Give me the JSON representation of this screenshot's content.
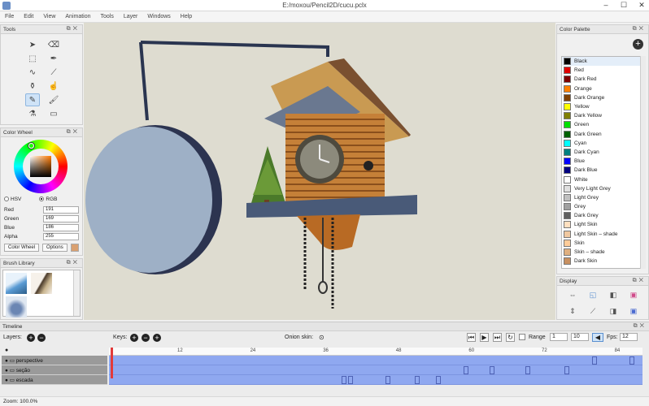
{
  "window": {
    "title": "E:/moxou/Pencil2D/cucu.pclx"
  },
  "menu": [
    "File",
    "Edit",
    "View",
    "Animation",
    "Tools",
    "Layer",
    "Windows",
    "Help"
  ],
  "tools_panel": {
    "title": "Tools"
  },
  "tools": [
    {
      "name": "select-arrow-icon",
      "glyph": "➤",
      "active": false
    },
    {
      "name": "clear-icon",
      "glyph": "⌫",
      "active": false
    },
    {
      "name": "select-rect-icon",
      "glyph": "⬚",
      "active": false
    },
    {
      "name": "pen-icon",
      "glyph": "✒",
      "active": false
    },
    {
      "name": "lasso-icon",
      "glyph": "∿",
      "active": false
    },
    {
      "name": "polyline-icon",
      "glyph": "⟋",
      "active": false
    },
    {
      "name": "bucket-icon",
      "glyph": "⚱",
      "active": false
    },
    {
      "name": "smudge-icon",
      "glyph": "☝",
      "active": false
    },
    {
      "name": "pencil-icon",
      "glyph": "✎",
      "active": true
    },
    {
      "name": "brush-icon",
      "glyph": "🖌",
      "active": false
    },
    {
      "name": "eyedropper-icon",
      "glyph": "⚗",
      "active": false
    },
    {
      "name": "eraser-icon",
      "glyph": "▭",
      "active": false
    }
  ],
  "color_wheel": {
    "title": "Color Wheel",
    "hsv_label": "HSV",
    "rgb_label": "RGB",
    "red_label": "Red",
    "red": "191",
    "green_label": "Green",
    "green": "169",
    "blue_label": "Blue",
    "blue": "186",
    "alpha_label": "Alpha",
    "alpha": "255",
    "tab_label": "Color Wheel",
    "options_label": "Options"
  },
  "brush_library": {
    "title": "Brush Library"
  },
  "palette": {
    "title": "Color Palette",
    "add_label": "+",
    "items": [
      {
        "name": "Black",
        "color": "#000000"
      },
      {
        "name": "Red",
        "color": "#e00000"
      },
      {
        "name": "Dark Red",
        "color": "#800000"
      },
      {
        "name": "Orange",
        "color": "#ff8000"
      },
      {
        "name": "Dark Orange",
        "color": "#804000"
      },
      {
        "name": "Yellow",
        "color": "#ffff00"
      },
      {
        "name": "Dark Yellow",
        "color": "#808000"
      },
      {
        "name": "Green",
        "color": "#00e000"
      },
      {
        "name": "Dark Green",
        "color": "#006000"
      },
      {
        "name": "Cyan",
        "color": "#00ffff"
      },
      {
        "name": "Dark Cyan",
        "color": "#008080"
      },
      {
        "name": "Blue",
        "color": "#0000ff"
      },
      {
        "name": "Dark Blue",
        "color": "#000080"
      },
      {
        "name": "White",
        "color": "#ffffff"
      },
      {
        "name": "Very Light Grey",
        "color": "#e0e0e0"
      },
      {
        "name": "Light Grey",
        "color": "#c0c0c0"
      },
      {
        "name": "Grey",
        "color": "#a0a0a0"
      },
      {
        "name": "Dark Grey",
        "color": "#606060"
      },
      {
        "name": "Light Skin",
        "color": "#ffe0c0"
      },
      {
        "name": "Light Skin – shade",
        "color": "#f0c8a0"
      },
      {
        "name": "Skin",
        "color": "#ffcc99"
      },
      {
        "name": "Skin – shade",
        "color": "#e0b080"
      },
      {
        "name": "Dark Skin",
        "color": "#c89060"
      }
    ]
  },
  "display_panel": {
    "title": "Display"
  },
  "timeline": {
    "title": "Timeline",
    "layers_label": "Layers:",
    "keys_label": "Keys:",
    "onion_label": "Onion skin:",
    "range_label": "Range",
    "range_from": "1",
    "range_to": "10",
    "fps_label": "Fps:",
    "fps": "12",
    "ruler_ticks": [
      "12",
      "24",
      "36",
      "48",
      "60",
      "72",
      "84"
    ],
    "layers": [
      {
        "name": "perspective"
      },
      {
        "name": "seção"
      },
      {
        "name": "escada"
      }
    ]
  },
  "status": {
    "zoom": "Zoom: 100.0%"
  }
}
